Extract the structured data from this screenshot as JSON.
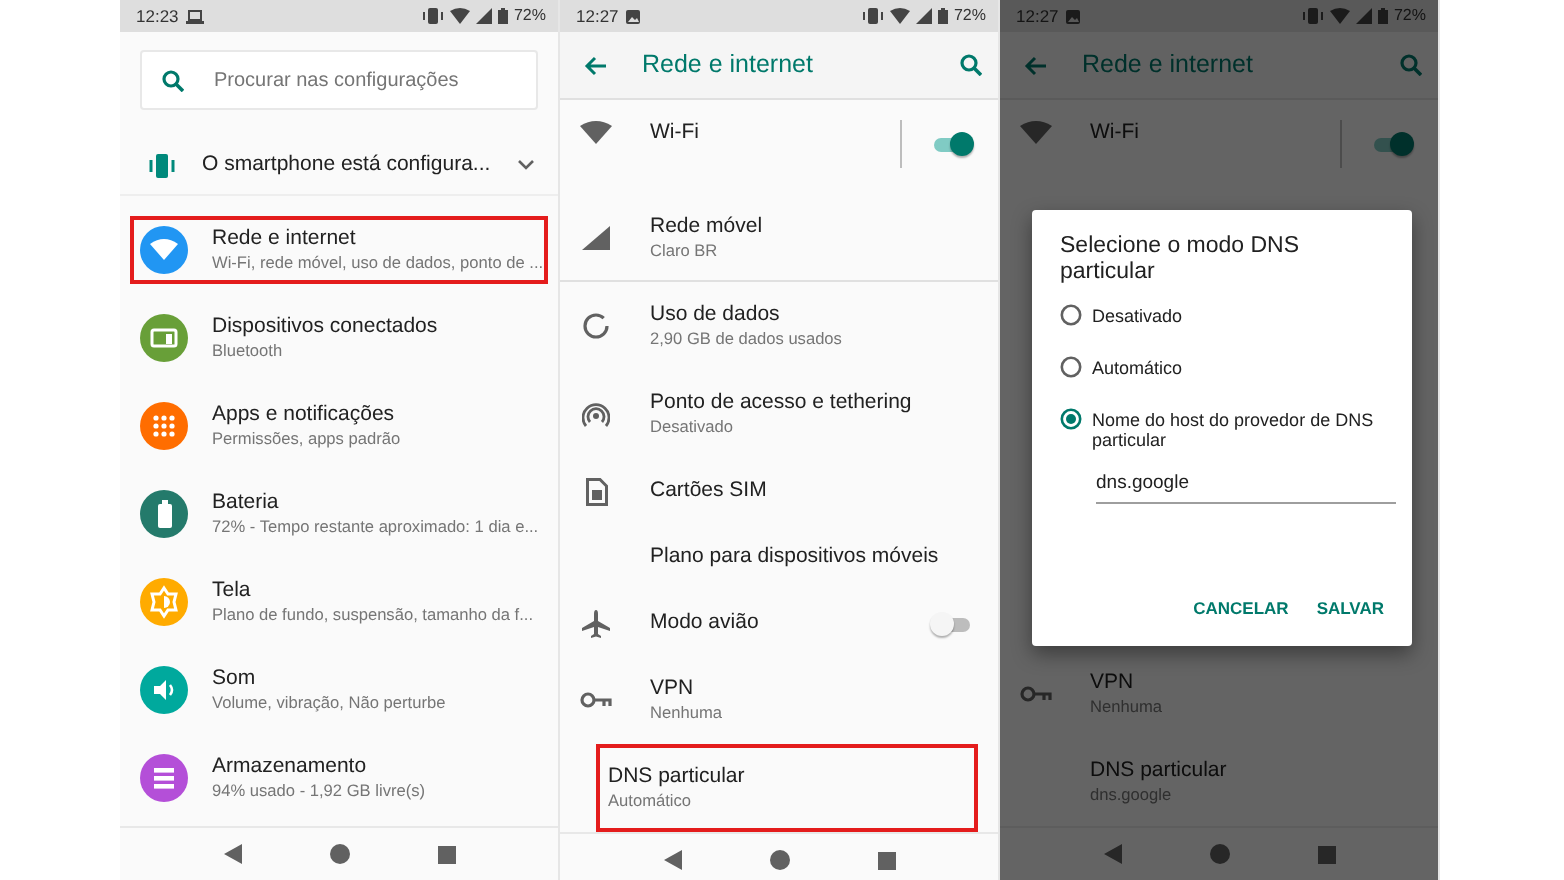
{
  "screens": [
    {
      "kind": "home",
      "status_bar": {
        "time": "12:23",
        "battery": "72%"
      },
      "search": {
        "placeholder": "Procurar nas configurações"
      },
      "suggestion": {
        "title": "O smartphone está configura..."
      },
      "items": [
        {
          "title": "Rede e internet",
          "subtitle": "Wi-Fi, rede móvel, uso de dados, ponto de ...",
          "color": "#2196f3",
          "highlighted": true
        },
        {
          "title": "Dispositivos conectados",
          "subtitle": "Bluetooth",
          "color": "#689f38",
          "highlighted": false
        },
        {
          "title": "Apps e notificações",
          "subtitle": "Permissões, apps padrão",
          "color": "#ff6d00",
          "highlighted": false
        },
        {
          "title": "Bateria",
          "subtitle": "72% - Tempo restante aproximado: 1 dia e...",
          "color": "#247a6b",
          "highlighted": false
        },
        {
          "title": "Tela",
          "subtitle": "Plano de fundo, suspensão, tamanho da f...",
          "color": "#ffab00",
          "highlighted": false
        },
        {
          "title": "Som",
          "subtitle": "Volume, vibração, Não perturbe",
          "color": "#00a99d",
          "highlighted": false
        },
        {
          "title": "Armazenamento",
          "subtitle": "94% usado - 1,92 GB livre(s)",
          "color": "#b44fd8",
          "highlighted": false
        }
      ]
    },
    {
      "kind": "network",
      "status_bar": {
        "time": "12:27",
        "battery": "72%"
      },
      "title": "Rede e internet",
      "items": [
        {
          "kind": "split-toggle",
          "title": "Wi-Fi",
          "on": true,
          "highlighted": false
        },
        {
          "kind": "plain",
          "title": "Rede móvel",
          "subtitle": "Claro BR",
          "highlighted": false
        },
        {
          "kind": "plain",
          "title": "Uso de dados",
          "subtitle": "2,90 GB de dados usados",
          "highlighted": false
        },
        {
          "kind": "plain",
          "title": "Ponto de acesso e tethering",
          "subtitle": "Desativado",
          "highlighted": false
        },
        {
          "kind": "plain",
          "title": "Cartões SIM",
          "highlighted": false
        },
        {
          "kind": "plain",
          "title": "Plano para dispositivos móveis",
          "highlighted": false
        },
        {
          "kind": "toggle",
          "title": "Modo avião",
          "on": false,
          "highlighted": false
        },
        {
          "kind": "plain",
          "title": "VPN",
          "subtitle": "Nenhuma",
          "highlighted": false
        },
        {
          "kind": "plain",
          "title": "DNS particular",
          "subtitle": "Automático",
          "highlighted": true
        }
      ]
    },
    {
      "kind": "network",
      "status_bar": {
        "time": "12:27",
        "battery": "72%"
      },
      "title": "Rede e internet",
      "items": [
        {
          "kind": "split-toggle",
          "title": "Wi-Fi",
          "on": true,
          "highlighted": false
        },
        {
          "kind": "plain",
          "title": "VPN",
          "subtitle": "Nenhuma",
          "highlighted": false
        },
        {
          "kind": "plain",
          "title": "DNS particular",
          "subtitle": "dns.google",
          "highlighted": false
        }
      ],
      "dialog": {
        "title": "Selecione o modo DNS particular",
        "options": [
          {
            "label": "Desativado",
            "selected": false
          },
          {
            "label": "Automático",
            "selected": false
          },
          {
            "label": "Nome do host do provedor de DNS particular",
            "selected": true
          }
        ],
        "input": {
          "value": "dns.google"
        },
        "buttons": [
          "CANCELAR",
          "SALVAR"
        ]
      }
    }
  ]
}
